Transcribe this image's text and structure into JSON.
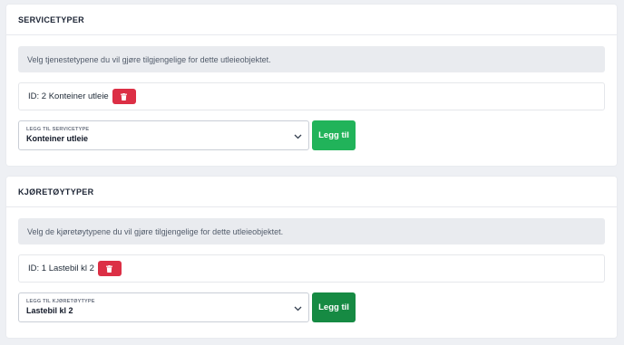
{
  "colors": {
    "delete_button": "#dc2f45",
    "add_button_services": "#21b35a",
    "add_button_vehicles": "#168a43"
  },
  "services": {
    "title": "SERVICETYPER",
    "info": "Velg tjenestetypene du vil gjøre tilgjengelige for dette utleieobjektet.",
    "items": [
      {
        "text": "ID: 2 Konteiner utleie",
        "delete_icon": "trash-icon"
      }
    ],
    "select": {
      "label": "LEGG TIL SERVICETYPE",
      "value": "Konteiner utleie",
      "chevron_icon": "chevron-down-icon"
    },
    "add_label": "Legg til"
  },
  "vehicles": {
    "title": "KJØRETØYTYPER",
    "info": "Velg de kjøretøytypene du vil gjøre tilgjengelige for dette utleieobjektet.",
    "items": [
      {
        "text": "ID: 1 Lastebil kl 2",
        "delete_icon": "trash-icon"
      }
    ],
    "select": {
      "label": "LEGG TIL KJØRETØYTYPE",
      "value": "Lastebil kl 2",
      "chevron_icon": "chevron-down-icon"
    },
    "add_label": "Legg til"
  }
}
